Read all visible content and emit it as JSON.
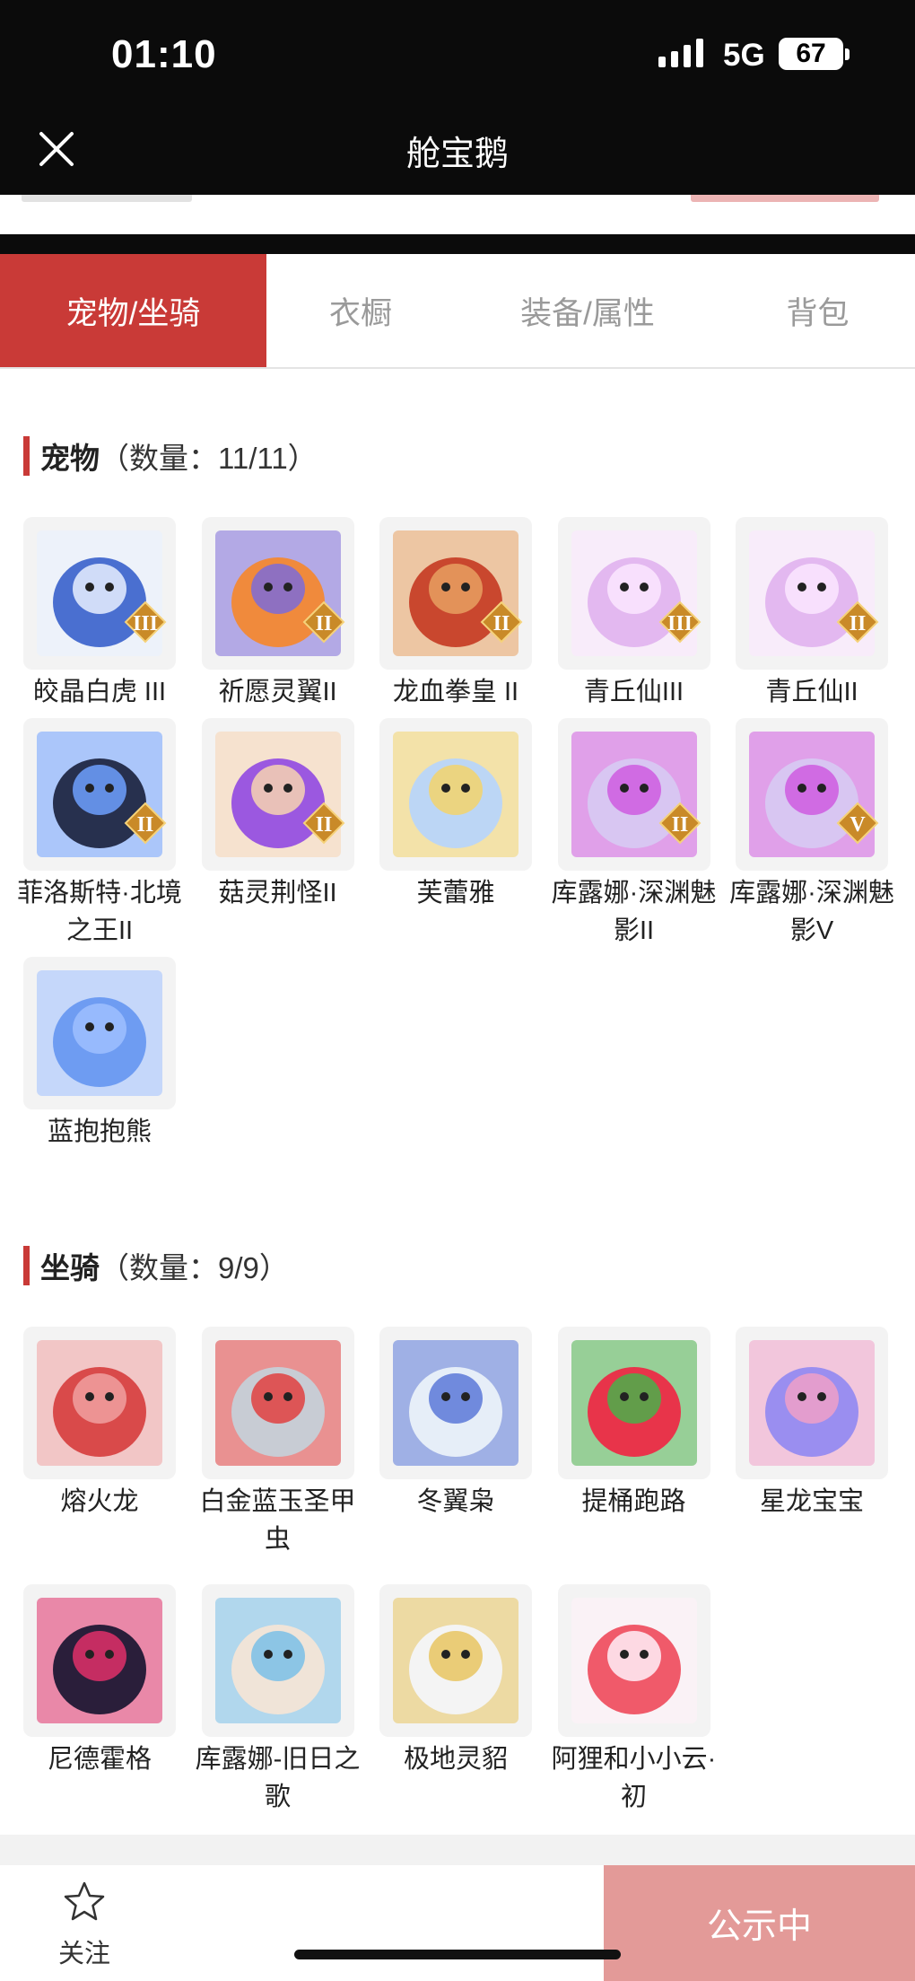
{
  "status_bar": {
    "time": "01:10",
    "network": "5G",
    "battery": "67"
  },
  "header": {
    "title": "舱宝鹅",
    "close_icon": "close-icon"
  },
  "tabs": [
    {
      "label": "宠物/坐骑",
      "active": true
    },
    {
      "label": "衣橱",
      "active": false
    },
    {
      "label": "装备/属性",
      "active": false
    },
    {
      "label": "背包",
      "active": false
    }
  ],
  "pets": {
    "title": "宠物",
    "count": "（数量：11/11）",
    "items": [
      {
        "name": "皎晶白虎 III",
        "badge": "III",
        "colors": [
          "#4a6fd0",
          "#e8f0ff"
        ]
      },
      {
        "name": "祈愿灵翼II",
        "badge": "II",
        "colors": [
          "#f08a3c",
          "#7d6bd8"
        ]
      },
      {
        "name": "龙血拳皇 II",
        "badge": "II",
        "colors": [
          "#c9472e",
          "#e8a060"
        ]
      },
      {
        "name": "青丘仙III",
        "badge": "III",
        "colors": [
          "#e3b8f0",
          "#fbe6ff"
        ]
      },
      {
        "name": "青丘仙II",
        "badge": "II",
        "colors": [
          "#e3b8f0",
          "#fbe6ff"
        ]
      },
      {
        "name": "菲洛斯特·北境之王II",
        "badge": "II",
        "colors": [
          "#27304e",
          "#6fa0ff"
        ]
      },
      {
        "name": "菇灵荆怪II",
        "badge": "II",
        "colors": [
          "#9b58e0",
          "#f7d3b0"
        ]
      },
      {
        "name": "芙蕾雅",
        "badge": "",
        "colors": [
          "#bcd6f5",
          "#f3d36b"
        ]
      },
      {
        "name": "库露娜·深渊魅影II",
        "badge": "II",
        "colors": [
          "#d8c6f2",
          "#cf5be0"
        ]
      },
      {
        "name": "库露娜·深渊魅影V",
        "badge": "V",
        "colors": [
          "#d8c6f2",
          "#cf5be0"
        ]
      },
      {
        "name": "蓝抱抱熊",
        "badge": "",
        "colors": [
          "#6e9cf2",
          "#9fc0ff"
        ]
      }
    ]
  },
  "mounts": {
    "title": "坐骑",
    "count": "（数量：9/9）",
    "items": [
      {
        "name": "熔火龙",
        "colors": [
          "#d94a4a",
          "#f0a0a0"
        ]
      },
      {
        "name": "白金蓝玉圣甲虫",
        "colors": [
          "#c8ccd4",
          "#e04040"
        ]
      },
      {
        "name": "冬翼枭",
        "colors": [
          "#e6eef8",
          "#5a78d8"
        ]
      },
      {
        "name": "提桶跑路",
        "colors": [
          "#e8344a",
          "#4ab04a"
        ]
      },
      {
        "name": "星龙宝宝",
        "colors": [
          "#9a8ef0",
          "#f0a0c8"
        ]
      },
      {
        "name": "尼德霍格",
        "colors": [
          "#2a1e3a",
          "#e0306a"
        ]
      },
      {
        "name": "库露娜-旧日之歌",
        "colors": [
          "#f0e4d8",
          "#7ac0e8"
        ]
      },
      {
        "name": "极地灵貂",
        "colors": [
          "#f4f4f4",
          "#e8c460"
        ]
      },
      {
        "name": "阿狸和小小云·初",
        "colors": [
          "#f05a6a",
          "#fff0f8"
        ]
      }
    ]
  },
  "bottom_bar": {
    "follow_label": "关注",
    "status_button": "公示中"
  }
}
